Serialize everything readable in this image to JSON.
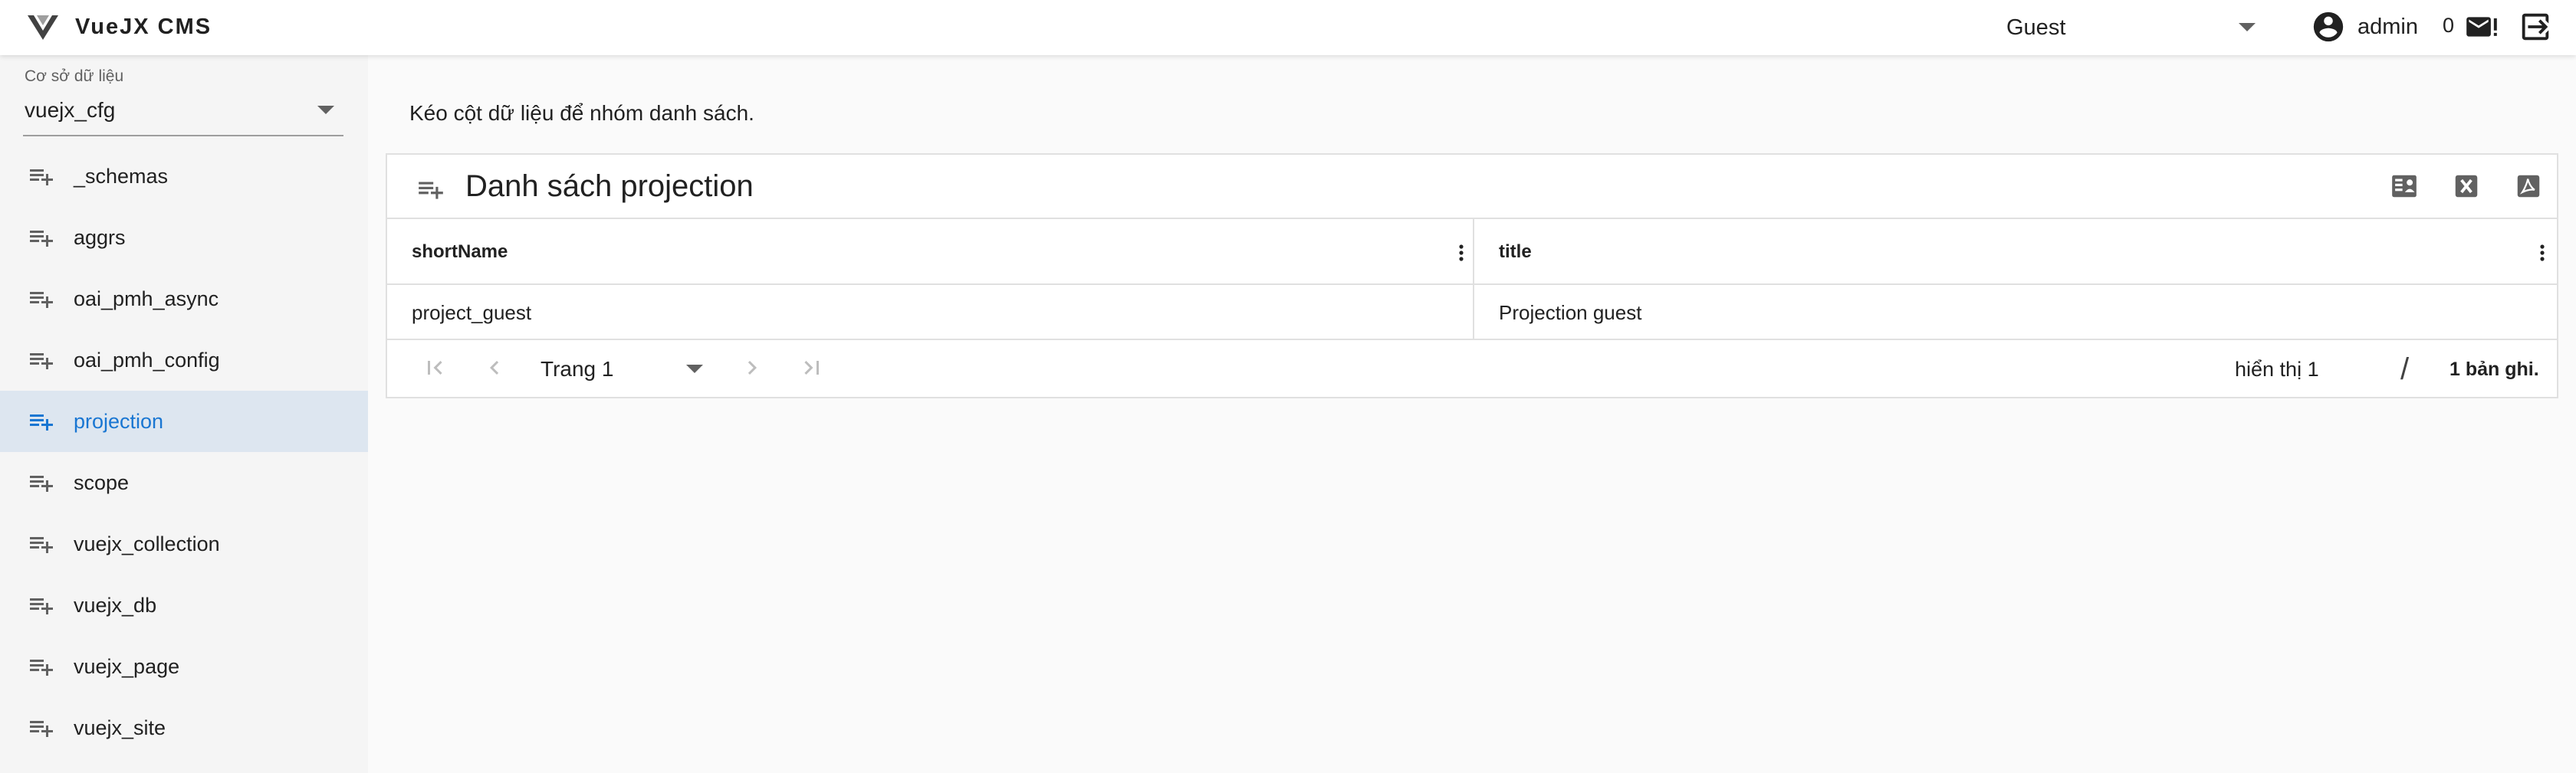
{
  "header": {
    "brand": "VueJX CMS",
    "role": "Guest",
    "username": "admin",
    "message_count": "0"
  },
  "sidebar": {
    "database_label": "Cơ sở dữ liệu",
    "database_value": "vuejx_cfg",
    "items": [
      {
        "label": "_schemas",
        "active": false
      },
      {
        "label": "aggrs",
        "active": false
      },
      {
        "label": "oai_pmh_async",
        "active": false
      },
      {
        "label": "oai_pmh_config",
        "active": false
      },
      {
        "label": "projection",
        "active": true
      },
      {
        "label": "scope",
        "active": false
      },
      {
        "label": "vuejx_collection",
        "active": false
      },
      {
        "label": "vuejx_db",
        "active": false
      },
      {
        "label": "vuejx_page",
        "active": false
      },
      {
        "label": "vuejx_site",
        "active": false
      }
    ]
  },
  "main": {
    "group_hint": "Kéo cột dữ liệu để nhóm danh sách.",
    "title": "Danh sách projection",
    "toolbar_icons": [
      "form-icon",
      "excel-icon",
      "pdf-icon"
    ],
    "columns": [
      "shortName",
      "title"
    ],
    "rows": [
      [
        "project_guest",
        "Projection guest"
      ]
    ],
    "pagination": {
      "page": "Trang 1",
      "showing": "hiển thị 1",
      "separator": "/",
      "total": "1 bản ghi."
    }
  },
  "colors": {
    "accent": "#1976d2",
    "active_bg": "#dde6f0",
    "sidebar_bg": "#f5f5f5",
    "page_bg": "#fafafa"
  }
}
